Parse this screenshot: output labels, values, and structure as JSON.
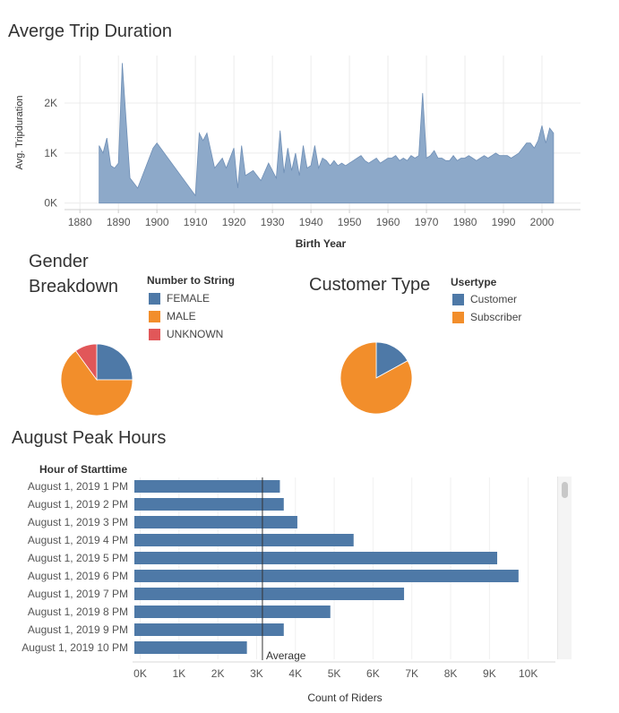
{
  "area_chart": {
    "title": "Averge Trip Duration",
    "ylabel": "Avg. Tripduration",
    "xlabel": "Birth Year",
    "y_ticks": [
      {
        "v": 0,
        "label": "0K"
      },
      {
        "v": 1000,
        "label": "1K"
      },
      {
        "v": 2000,
        "label": "2K"
      }
    ],
    "x_ticks": [
      1880,
      1890,
      1900,
      1910,
      1920,
      1930,
      1940,
      1950,
      1960,
      1970,
      1980,
      1990,
      2000
    ],
    "color": "#8da9c9",
    "stroke": "#6f8fb6"
  },
  "gender_pie": {
    "title_line1": "Gender",
    "title_line2": "Breakdown",
    "legend_title": "Number to String",
    "legend": [
      {
        "label": "FEMALE",
        "color": "#4e79a7"
      },
      {
        "label": "MALE",
        "color": "#f28e2b"
      },
      {
        "label": "UNKNOWN",
        "color": "#e15759"
      }
    ]
  },
  "customer_pie": {
    "title": "Customer Type",
    "legend_title": "Usertype",
    "legend": [
      {
        "label": "Customer",
        "color": "#4e79a7"
      },
      {
        "label": "Subscriber",
        "color": "#f28e2b"
      }
    ]
  },
  "bar_chart": {
    "title": "August Peak Hours",
    "row_header": "Hour of Starttime",
    "xlabel": "Count of Riders",
    "average_label": "Average",
    "average_value": 3150,
    "x_ticks": [
      {
        "v": 0,
        "label": "0K"
      },
      {
        "v": 1000,
        "label": "1K"
      },
      {
        "v": 2000,
        "label": "2K"
      },
      {
        "v": 3000,
        "label": "3K"
      },
      {
        "v": 4000,
        "label": "4K"
      },
      {
        "v": 5000,
        "label": "5K"
      },
      {
        "v": 6000,
        "label": "6K"
      },
      {
        "v": 7000,
        "label": "7K"
      },
      {
        "v": 8000,
        "label": "8K"
      },
      {
        "v": 9000,
        "label": "9K"
      },
      {
        "v": 10000,
        "label": "10K"
      }
    ],
    "color": "#4e79a7"
  },
  "chart_data": [
    {
      "type": "area",
      "title": "Averge Trip Duration",
      "xlabel": "Birth Year",
      "ylabel": "Avg. Tripduration",
      "xlim": [
        1876,
        2010
      ],
      "ylim": [
        -130,
        2950
      ],
      "grid": true,
      "x": [
        1885,
        1886,
        1887,
        1888,
        1889,
        1890,
        1891,
        1893,
        1895,
        1899,
        1900,
        1910,
        1911,
        1912,
        1913,
        1915,
        1917,
        1918,
        1920,
        1921,
        1922,
        1923,
        1925,
        1927,
        1929,
        1931,
        1932,
        1933,
        1934,
        1935,
        1936,
        1937,
        1938,
        1939,
        1940,
        1941,
        1942,
        1943,
        1944,
        1945,
        1946,
        1947,
        1948,
        1949,
        1950,
        1951,
        1952,
        1953,
        1954,
        1955,
        1956,
        1957,
        1958,
        1959,
        1960,
        1961,
        1962,
        1963,
        1964,
        1965,
        1966,
        1967,
        1968,
        1969,
        1970,
        1971,
        1972,
        1973,
        1974,
        1975,
        1976,
        1977,
        1978,
        1979,
        1980,
        1981,
        1982,
        1983,
        1984,
        1985,
        1986,
        1987,
        1988,
        1989,
        1990,
        1991,
        1992,
        1993,
        1994,
        1995,
        1996,
        1997,
        1998,
        1999,
        2000,
        2001,
        2002,
        2003
      ],
      "y": [
        1150,
        1000,
        1300,
        750,
        700,
        800,
        2800,
        500,
        300,
        1100,
        1200,
        150,
        1400,
        1250,
        1400,
        700,
        900,
        700,
        1100,
        300,
        1150,
        550,
        650,
        450,
        800,
        500,
        1450,
        600,
        1100,
        650,
        1000,
        550,
        1150,
        700,
        750,
        1150,
        700,
        900,
        850,
        750,
        850,
        750,
        800,
        750,
        800,
        850,
        900,
        950,
        850,
        800,
        850,
        900,
        800,
        850,
        900,
        900,
        950,
        850,
        900,
        850,
        950,
        900,
        950,
        2200,
        900,
        950,
        1050,
        900,
        900,
        850,
        850,
        950,
        850,
        900,
        900,
        950,
        900,
        850,
        900,
        950,
        900,
        950,
        1000,
        950,
        950,
        950,
        900,
        950,
        1000,
        1100,
        1200,
        1200,
        1100,
        1250,
        1550,
        1200,
        1500,
        1400
      ]
    },
    {
      "type": "pie",
      "title": "Gender Breakdown",
      "legend_title": "Number to String",
      "labels": [
        "FEMALE",
        "MALE",
        "UNKNOWN"
      ],
      "values": [
        25,
        65,
        10
      ]
    },
    {
      "type": "pie",
      "title": "Customer Type",
      "legend_title": "Usertype",
      "labels": [
        "Customer",
        "Subscriber"
      ],
      "values": [
        17,
        83
      ]
    },
    {
      "type": "bar",
      "orientation": "horizontal",
      "title": "August Peak Hours",
      "xlabel": "Count of Riders",
      "ylabel": "Hour of Starttime",
      "xlim": [
        -150,
        10700
      ],
      "categories": [
        "August 1, 2019 1 PM",
        "August 1, 2019 2 PM",
        "August 1, 2019 3 PM",
        "August 1, 2019 4 PM",
        "August 1, 2019 5 PM",
        "August 1, 2019 6 PM",
        "August 1, 2019 7 PM",
        "August 1, 2019 8 PM",
        "August 1, 2019 9 PM",
        "August 1, 2019 10 PM"
      ],
      "values": [
        3600,
        3700,
        4050,
        5500,
        9200,
        9750,
        6800,
        4900,
        3700,
        2750
      ],
      "reference_line": {
        "label": "Average",
        "value": 3150
      }
    }
  ]
}
